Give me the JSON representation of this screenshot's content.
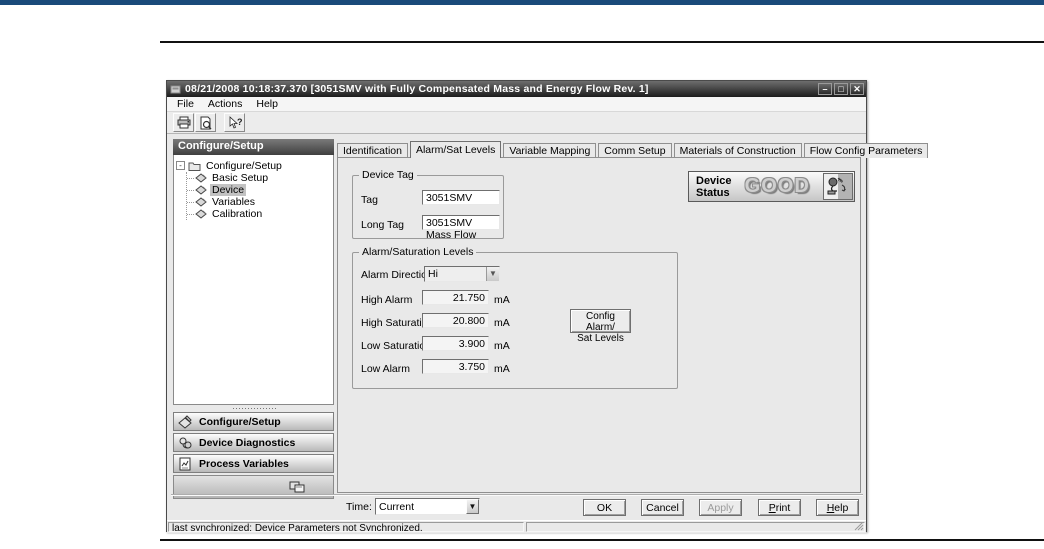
{
  "page": {
    "top_bar_color": "#1a4a7a"
  },
  "chrome": {
    "title": "08/21/2008 10:18:37.370 [3051SMV with Fully Compensated Mass and Energy Flow Rev. 1]",
    "menu": {
      "file": "File",
      "actions": "Actions",
      "help": "Help"
    },
    "window_buttons": {
      "minimize": "–",
      "maximize": "□",
      "close": "✕"
    }
  },
  "sidebar": {
    "header": "Configure/Setup",
    "tree_root": "Configure/Setup",
    "tree_items": [
      {
        "label": "Basic Setup"
      },
      {
        "label": "Device"
      },
      {
        "label": "Variables"
      },
      {
        "label": "Calibration"
      }
    ],
    "nav_buttons": [
      {
        "label": "Configure/Setup"
      },
      {
        "label": "Device Diagnostics"
      },
      {
        "label": "Process Variables"
      }
    ]
  },
  "tabs": [
    {
      "label": "Identification"
    },
    {
      "label": "Alarm/Sat Levels"
    },
    {
      "label": "Variable Mapping"
    },
    {
      "label": "Comm Setup"
    },
    {
      "label": "Materials of Construction"
    },
    {
      "label": "Flow Config Parameters"
    }
  ],
  "device_tag": {
    "title": "Device Tag",
    "tag_label": "Tag",
    "tag_value": "3051SMV",
    "long_tag_label": "Long Tag",
    "long_tag_value": "3051SMV Mass Flow"
  },
  "device_status": {
    "label_line1": "Device",
    "label_line2": "Status",
    "value": "GOOD"
  },
  "alarm": {
    "title": "Alarm/Saturation Levels",
    "direction_label": "Alarm Direction",
    "direction_value": "Hi",
    "rows": [
      {
        "label": "High Alarm",
        "value": "21.750",
        "unit": "mA"
      },
      {
        "label": "High Saturation",
        "value": "20.800",
        "unit": "mA"
      },
      {
        "label": "Low Saturation",
        "value": "3.900",
        "unit": "mA"
      },
      {
        "label": "Low Alarm",
        "value": "3.750",
        "unit": "mA"
      }
    ],
    "config_button_line1": "Config Alarm/",
    "config_button_line2": "Sat Levels"
  },
  "footer": {
    "time_label": "Time:",
    "time_value": "Current",
    "ok": "OK",
    "cancel": "Cancel",
    "apply": "Apply",
    "print": "Print",
    "help": "Help"
  },
  "status_bar": {
    "text": "last synchronized: Device Parameters not Synchronized."
  }
}
